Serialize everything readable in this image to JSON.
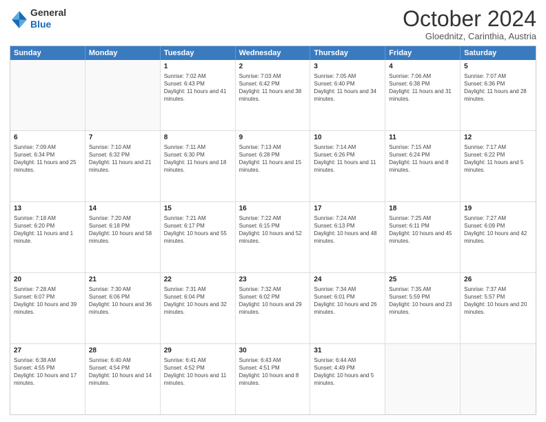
{
  "logo": {
    "line1": "General",
    "line2": "Blue"
  },
  "title": "October 2024",
  "location": "Gloednitz, Carinthia, Austria",
  "days": [
    "Sunday",
    "Monday",
    "Tuesday",
    "Wednesday",
    "Thursday",
    "Friday",
    "Saturday"
  ],
  "rows": [
    [
      {
        "day": "",
        "lines": []
      },
      {
        "day": "",
        "lines": []
      },
      {
        "day": "1",
        "lines": [
          "Sunrise: 7:02 AM",
          "Sunset: 6:43 PM",
          "Daylight: 11 hours and 41 minutes."
        ]
      },
      {
        "day": "2",
        "lines": [
          "Sunrise: 7:03 AM",
          "Sunset: 6:42 PM",
          "Daylight: 11 hours and 38 minutes."
        ]
      },
      {
        "day": "3",
        "lines": [
          "Sunrise: 7:05 AM",
          "Sunset: 6:40 PM",
          "Daylight: 11 hours and 34 minutes."
        ]
      },
      {
        "day": "4",
        "lines": [
          "Sunrise: 7:06 AM",
          "Sunset: 6:38 PM",
          "Daylight: 11 hours and 31 minutes."
        ]
      },
      {
        "day": "5",
        "lines": [
          "Sunrise: 7:07 AM",
          "Sunset: 6:36 PM",
          "Daylight: 11 hours and 28 minutes."
        ]
      }
    ],
    [
      {
        "day": "6",
        "lines": [
          "Sunrise: 7:09 AM",
          "Sunset: 6:34 PM",
          "Daylight: 11 hours and 25 minutes."
        ]
      },
      {
        "day": "7",
        "lines": [
          "Sunrise: 7:10 AM",
          "Sunset: 6:32 PM",
          "Daylight: 11 hours and 21 minutes."
        ]
      },
      {
        "day": "8",
        "lines": [
          "Sunrise: 7:11 AM",
          "Sunset: 6:30 PM",
          "Daylight: 11 hours and 18 minutes."
        ]
      },
      {
        "day": "9",
        "lines": [
          "Sunrise: 7:13 AM",
          "Sunset: 6:28 PM",
          "Daylight: 11 hours and 15 minutes."
        ]
      },
      {
        "day": "10",
        "lines": [
          "Sunrise: 7:14 AM",
          "Sunset: 6:26 PM",
          "Daylight: 11 hours and 11 minutes."
        ]
      },
      {
        "day": "11",
        "lines": [
          "Sunrise: 7:15 AM",
          "Sunset: 6:24 PM",
          "Daylight: 11 hours and 8 minutes."
        ]
      },
      {
        "day": "12",
        "lines": [
          "Sunrise: 7:17 AM",
          "Sunset: 6:22 PM",
          "Daylight: 11 hours and 5 minutes."
        ]
      }
    ],
    [
      {
        "day": "13",
        "lines": [
          "Sunrise: 7:18 AM",
          "Sunset: 6:20 PM",
          "Daylight: 11 hours and 1 minute."
        ]
      },
      {
        "day": "14",
        "lines": [
          "Sunrise: 7:20 AM",
          "Sunset: 6:18 PM",
          "Daylight: 10 hours and 58 minutes."
        ]
      },
      {
        "day": "15",
        "lines": [
          "Sunrise: 7:21 AM",
          "Sunset: 6:17 PM",
          "Daylight: 10 hours and 55 minutes."
        ]
      },
      {
        "day": "16",
        "lines": [
          "Sunrise: 7:22 AM",
          "Sunset: 6:15 PM",
          "Daylight: 10 hours and 52 minutes."
        ]
      },
      {
        "day": "17",
        "lines": [
          "Sunrise: 7:24 AM",
          "Sunset: 6:13 PM",
          "Daylight: 10 hours and 48 minutes."
        ]
      },
      {
        "day": "18",
        "lines": [
          "Sunrise: 7:25 AM",
          "Sunset: 6:11 PM",
          "Daylight: 10 hours and 45 minutes."
        ]
      },
      {
        "day": "19",
        "lines": [
          "Sunrise: 7:27 AM",
          "Sunset: 6:09 PM",
          "Daylight: 10 hours and 42 minutes."
        ]
      }
    ],
    [
      {
        "day": "20",
        "lines": [
          "Sunrise: 7:28 AM",
          "Sunset: 6:07 PM",
          "Daylight: 10 hours and 39 minutes."
        ]
      },
      {
        "day": "21",
        "lines": [
          "Sunrise: 7:30 AM",
          "Sunset: 6:06 PM",
          "Daylight: 10 hours and 36 minutes."
        ]
      },
      {
        "day": "22",
        "lines": [
          "Sunrise: 7:31 AM",
          "Sunset: 6:04 PM",
          "Daylight: 10 hours and 32 minutes."
        ]
      },
      {
        "day": "23",
        "lines": [
          "Sunrise: 7:32 AM",
          "Sunset: 6:02 PM",
          "Daylight: 10 hours and 29 minutes."
        ]
      },
      {
        "day": "24",
        "lines": [
          "Sunrise: 7:34 AM",
          "Sunset: 6:01 PM",
          "Daylight: 10 hours and 26 minutes."
        ]
      },
      {
        "day": "25",
        "lines": [
          "Sunrise: 7:35 AM",
          "Sunset: 5:59 PM",
          "Daylight: 10 hours and 23 minutes."
        ]
      },
      {
        "day": "26",
        "lines": [
          "Sunrise: 7:37 AM",
          "Sunset: 5:57 PM",
          "Daylight: 10 hours and 20 minutes."
        ]
      }
    ],
    [
      {
        "day": "27",
        "lines": [
          "Sunrise: 6:38 AM",
          "Sunset: 4:55 PM",
          "Daylight: 10 hours and 17 minutes."
        ]
      },
      {
        "day": "28",
        "lines": [
          "Sunrise: 6:40 AM",
          "Sunset: 4:54 PM",
          "Daylight: 10 hours and 14 minutes."
        ]
      },
      {
        "day": "29",
        "lines": [
          "Sunrise: 6:41 AM",
          "Sunset: 4:52 PM",
          "Daylight: 10 hours and 11 minutes."
        ]
      },
      {
        "day": "30",
        "lines": [
          "Sunrise: 6:43 AM",
          "Sunset: 4:51 PM",
          "Daylight: 10 hours and 8 minutes."
        ]
      },
      {
        "day": "31",
        "lines": [
          "Sunrise: 6:44 AM",
          "Sunset: 4:49 PM",
          "Daylight: 10 hours and 5 minutes."
        ]
      },
      {
        "day": "",
        "lines": []
      },
      {
        "day": "",
        "lines": []
      }
    ]
  ]
}
